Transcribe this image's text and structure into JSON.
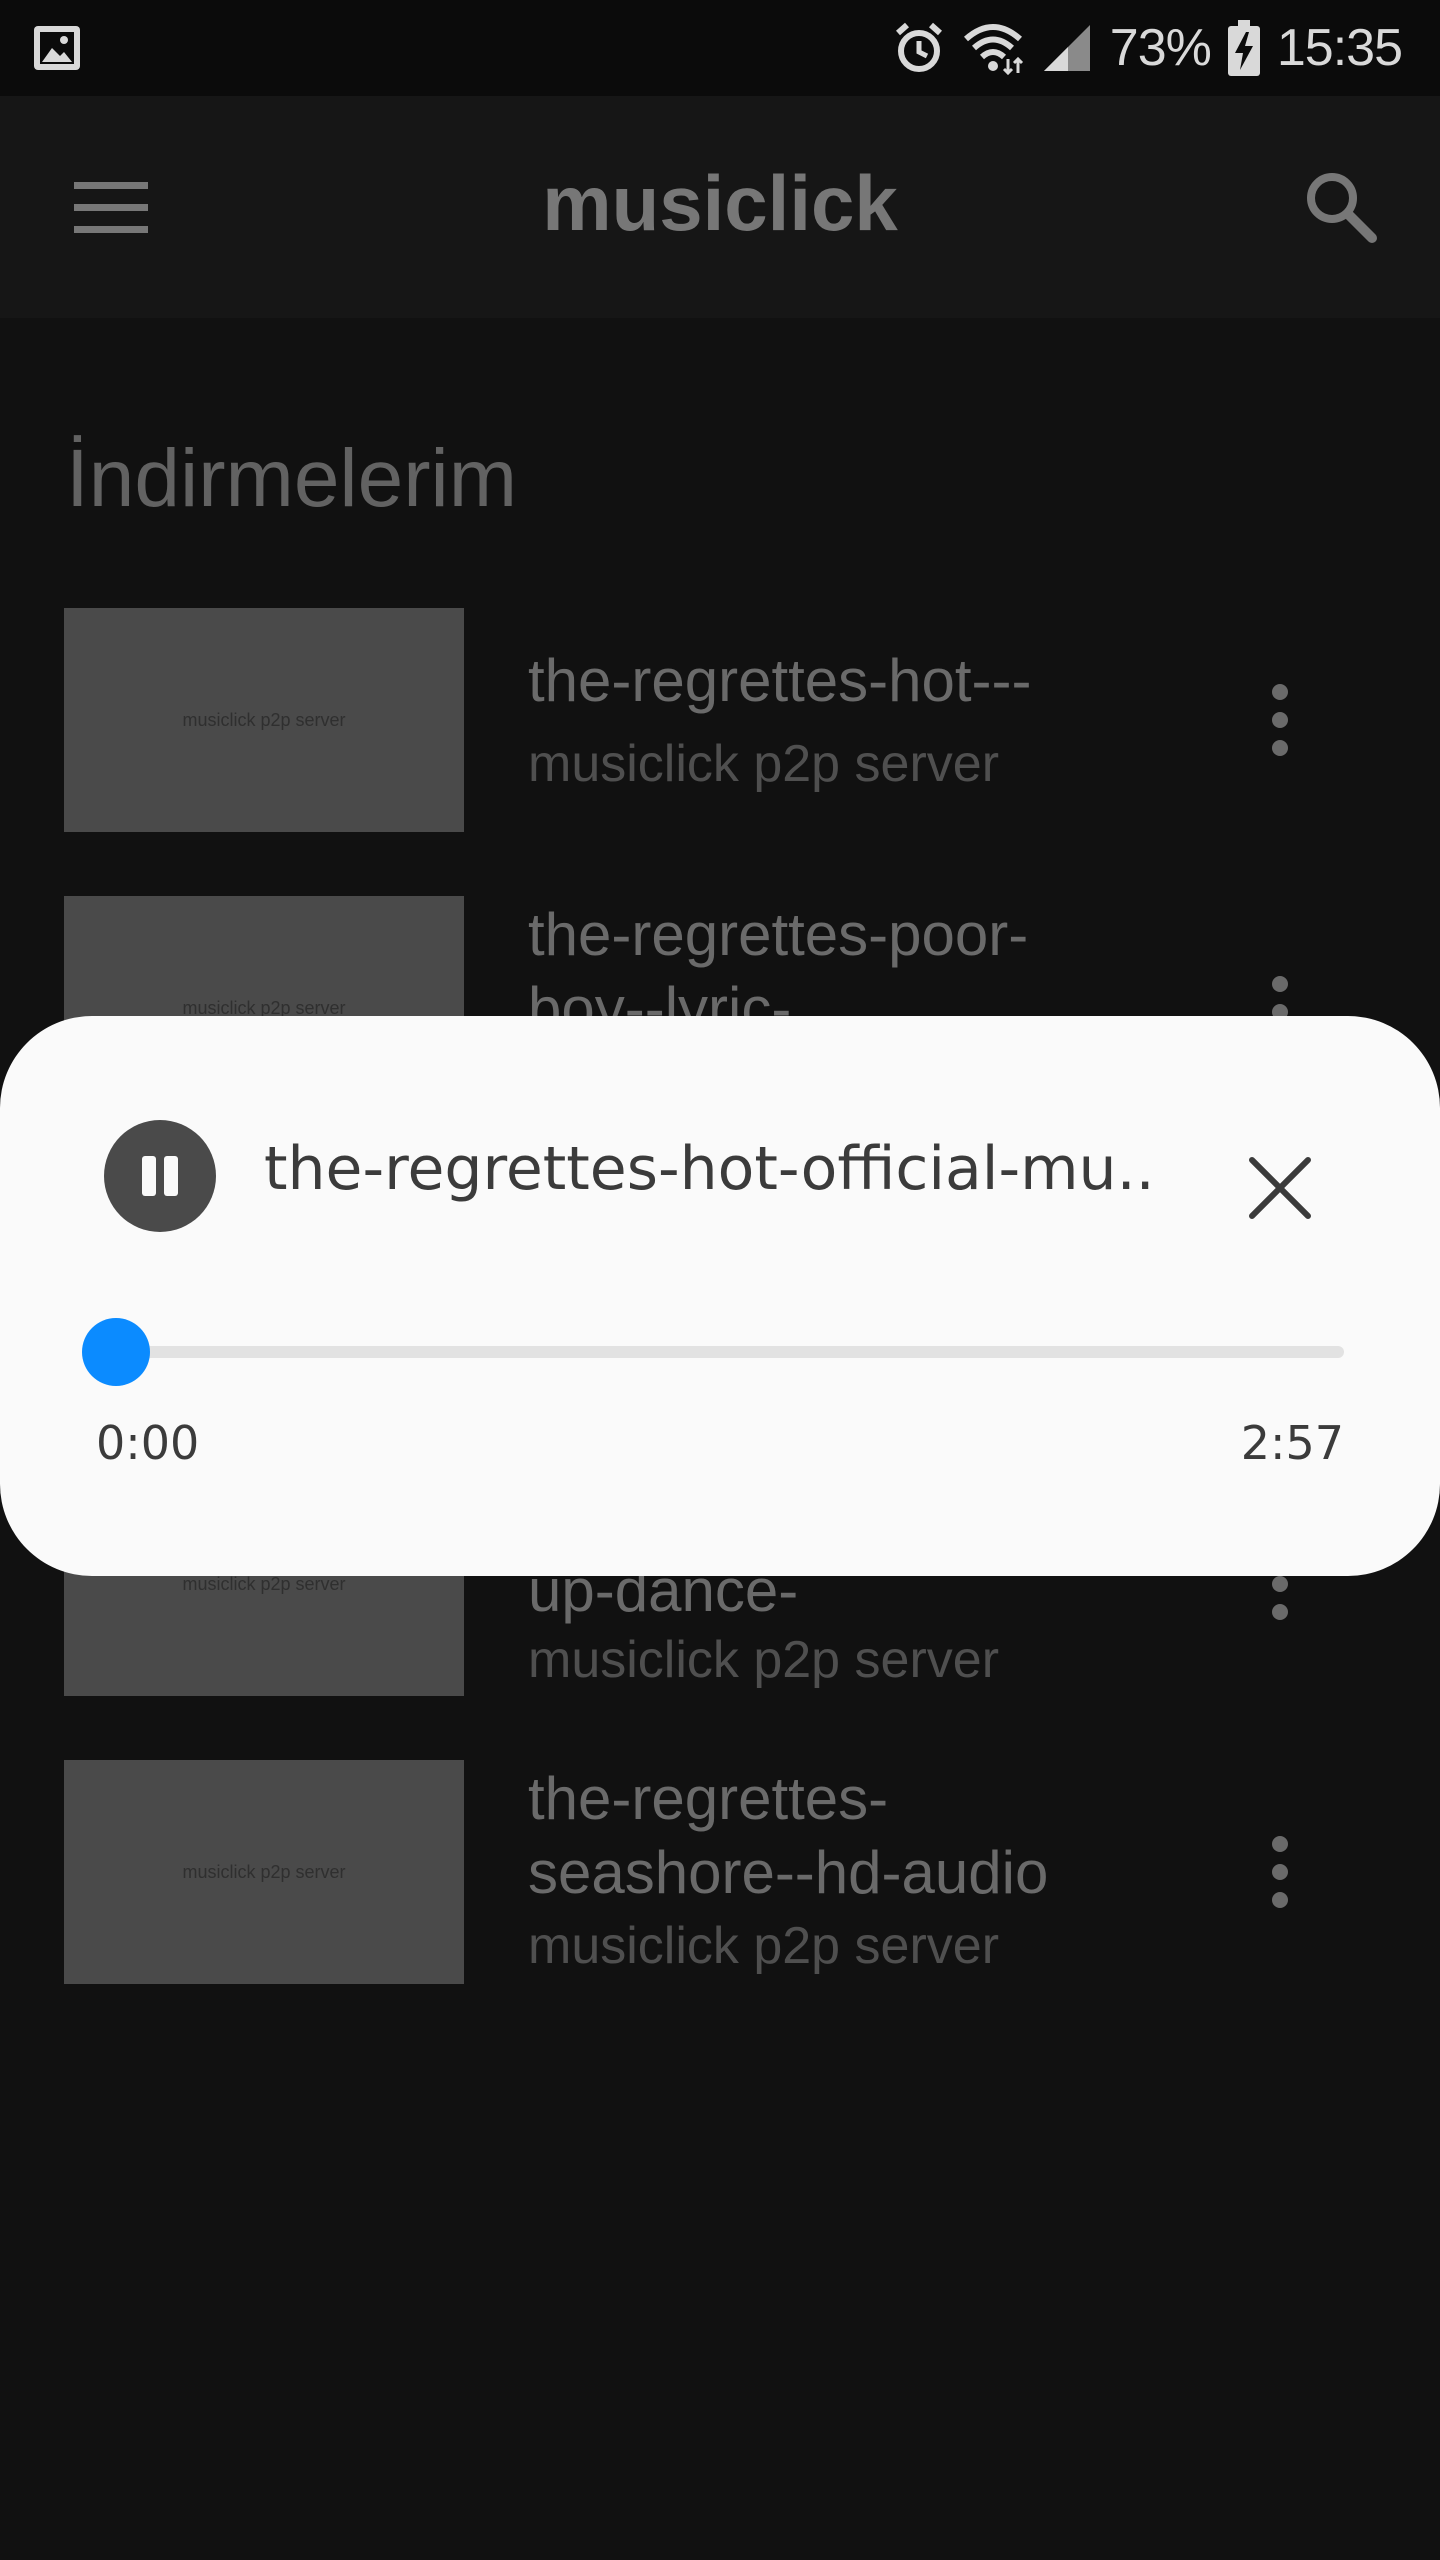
{
  "status_bar": {
    "left_icon": "image-icon",
    "icons": [
      "alarm-icon",
      "wifi-icon",
      "signal-icon",
      "battery-charging-icon"
    ],
    "battery": "73%",
    "time": "15:35"
  },
  "app_bar": {
    "title": "musiclick",
    "menu_icon": "menu-icon",
    "search_icon": "search-icon"
  },
  "section": {
    "title": "İndirmelerim"
  },
  "thumbnail_text": "musiclick p2p server",
  "list": {
    "items": [
      {
        "title": "the-regrettes-hot---",
        "subtitle": "musiclick p2p server"
      },
      {
        "title": "the-regrettes-poor-boy--lyric-",
        "subtitle": ""
      },
      {
        "title": "up-dance-",
        "subtitle": "musiclick p2p server"
      },
      {
        "title": "the-regrettes-seashore--hd-audio",
        "subtitle": "musiclick p2p server"
      }
    ]
  },
  "player": {
    "track_title": "the-regrettes-hot-official-mu..",
    "current_time": "0:00",
    "total_time": "2:57",
    "progress": 0.0,
    "accent_color": "#0b8bff",
    "pause_icon": "pause-icon",
    "close_icon": "close-icon"
  }
}
